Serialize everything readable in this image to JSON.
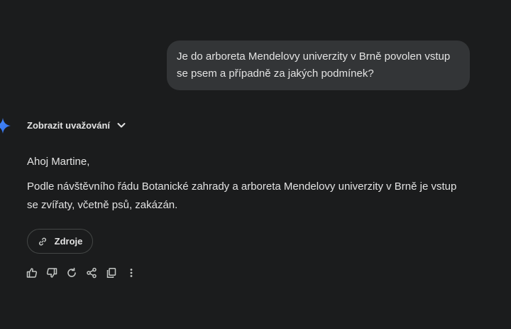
{
  "user_message": {
    "line1": "Je do arboreta Mendelovy univerzity v Brně povolen vstup",
    "line2": "se psem a případně za jakých podmínek?"
  },
  "assistant": {
    "avatar_icon": "gemini-sparkle-icon",
    "show_thinking_label": "Zobrazit uvažování",
    "greeting": "Ahoj Martine,",
    "answer": "Podle návštěvního řádu Botanické zahrady a arboreta Mendelovy univerzity v Brně je vstup se zvířaty, včetně psů, zakázán.",
    "sources_label": "Zdroje"
  },
  "action_bar": {
    "icons": [
      "thumbs-up-icon",
      "thumbs-down-icon",
      "regenerate-icon",
      "share-icon",
      "copy-icon",
      "more-options-icon"
    ]
  },
  "colors": {
    "background": "#1b1c1d",
    "bubble": "#333537",
    "text": "#e3e3e3",
    "muted_icon": "#c4c7c5",
    "accent_blue": "#4285f4"
  }
}
